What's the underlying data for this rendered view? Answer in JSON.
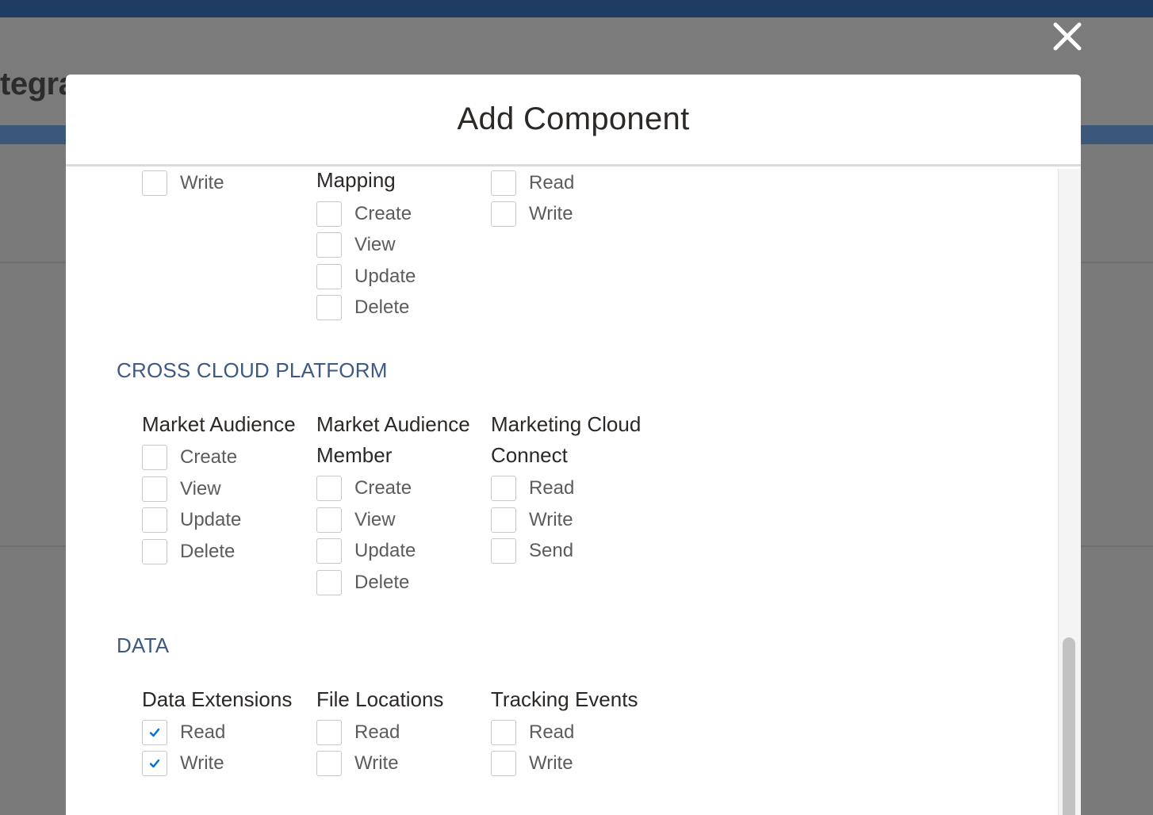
{
  "background": {
    "page_title_fragment": "tegra"
  },
  "modal": {
    "title": "Add Component",
    "close_icon": "close-icon"
  },
  "top_partial": {
    "col1": {
      "items": [
        {
          "label": "Write",
          "checked": false
        }
      ]
    },
    "col2": {
      "title_tail": "Mapping",
      "items": [
        {
          "label": "Create",
          "checked": false
        },
        {
          "label": "View",
          "checked": false
        },
        {
          "label": "Update",
          "checked": false
        },
        {
          "label": "Delete",
          "checked": false
        }
      ]
    },
    "col3": {
      "items": [
        {
          "label": "Read",
          "checked": false
        },
        {
          "label": "Write",
          "checked": false
        }
      ]
    }
  },
  "sections": [
    {
      "heading": "CROSS CLOUD PLATFORM",
      "groups": [
        {
          "title": "Market Audience",
          "items": [
            {
              "label": "Create",
              "checked": false
            },
            {
              "label": "View",
              "checked": false
            },
            {
              "label": "Update",
              "checked": false
            },
            {
              "label": "Delete",
              "checked": false
            }
          ]
        },
        {
          "title": "Market Audience Member",
          "items": [
            {
              "label": "Create",
              "checked": false
            },
            {
              "label": "View",
              "checked": false
            },
            {
              "label": "Update",
              "checked": false
            },
            {
              "label": "Delete",
              "checked": false
            }
          ]
        },
        {
          "title": "Marketing Cloud Connect",
          "items": [
            {
              "label": "Read",
              "checked": false
            },
            {
              "label": "Write",
              "checked": false
            },
            {
              "label": "Send",
              "checked": false
            }
          ]
        }
      ]
    },
    {
      "heading": "DATA",
      "groups": [
        {
          "title": "Data Extensions",
          "items": [
            {
              "label": "Read",
              "checked": true
            },
            {
              "label": "Write",
              "checked": true
            }
          ]
        },
        {
          "title": "File Locations",
          "items": [
            {
              "label": "Read",
              "checked": false
            },
            {
              "label": "Write",
              "checked": false
            }
          ]
        },
        {
          "title": "Tracking Events",
          "items": [
            {
              "label": "Read",
              "checked": false
            },
            {
              "label": "Write",
              "checked": false
            }
          ]
        }
      ]
    }
  ],
  "colors": {
    "heading": "#3e5a83",
    "check": "#0070d2",
    "checkbox_border": "#c9c7c5"
  }
}
